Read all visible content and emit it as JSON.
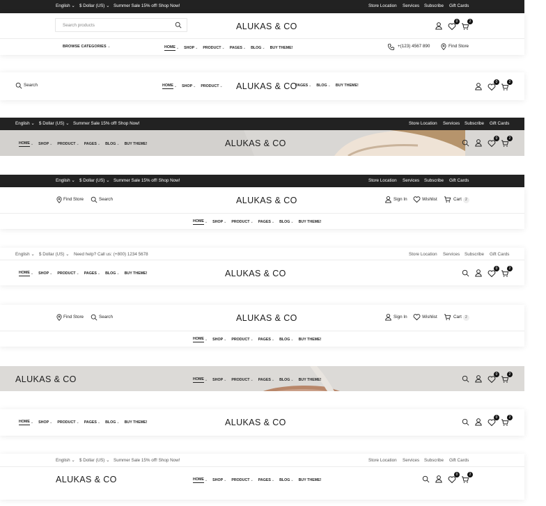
{
  "topbar": {
    "language": "English",
    "currency": "$ Dollar (US)",
    "promo": "Summer Sale 15% off! Shop Now!",
    "help": "Need help? Call us: (+800) 1234 5678",
    "links": [
      "Store Location",
      "Services",
      "Subscribe",
      "Gift Cards"
    ]
  },
  "brand": {
    "logo": "ALUKAS & CO"
  },
  "nav": {
    "items": [
      "HOME",
      "SHOP",
      "PRODUCT",
      "PAGES",
      "BLOG",
      "BUY THEME!"
    ],
    "categories": "BROWSE CATEGORIES"
  },
  "search": {
    "placeholder": "Search products",
    "label": "Search"
  },
  "contact": {
    "phone": "+(123) 4567 890",
    "find_store": "Find Store"
  },
  "account": {
    "sign_in": "Sign In",
    "wishlist": "Wishlist",
    "cart": "Cart"
  },
  "counts": {
    "wishlist": "0",
    "cart": "2"
  },
  "colors": {
    "dark_bar": "#222222",
    "hero_gray": "#dcdad7",
    "text": "#1b1b1b"
  }
}
